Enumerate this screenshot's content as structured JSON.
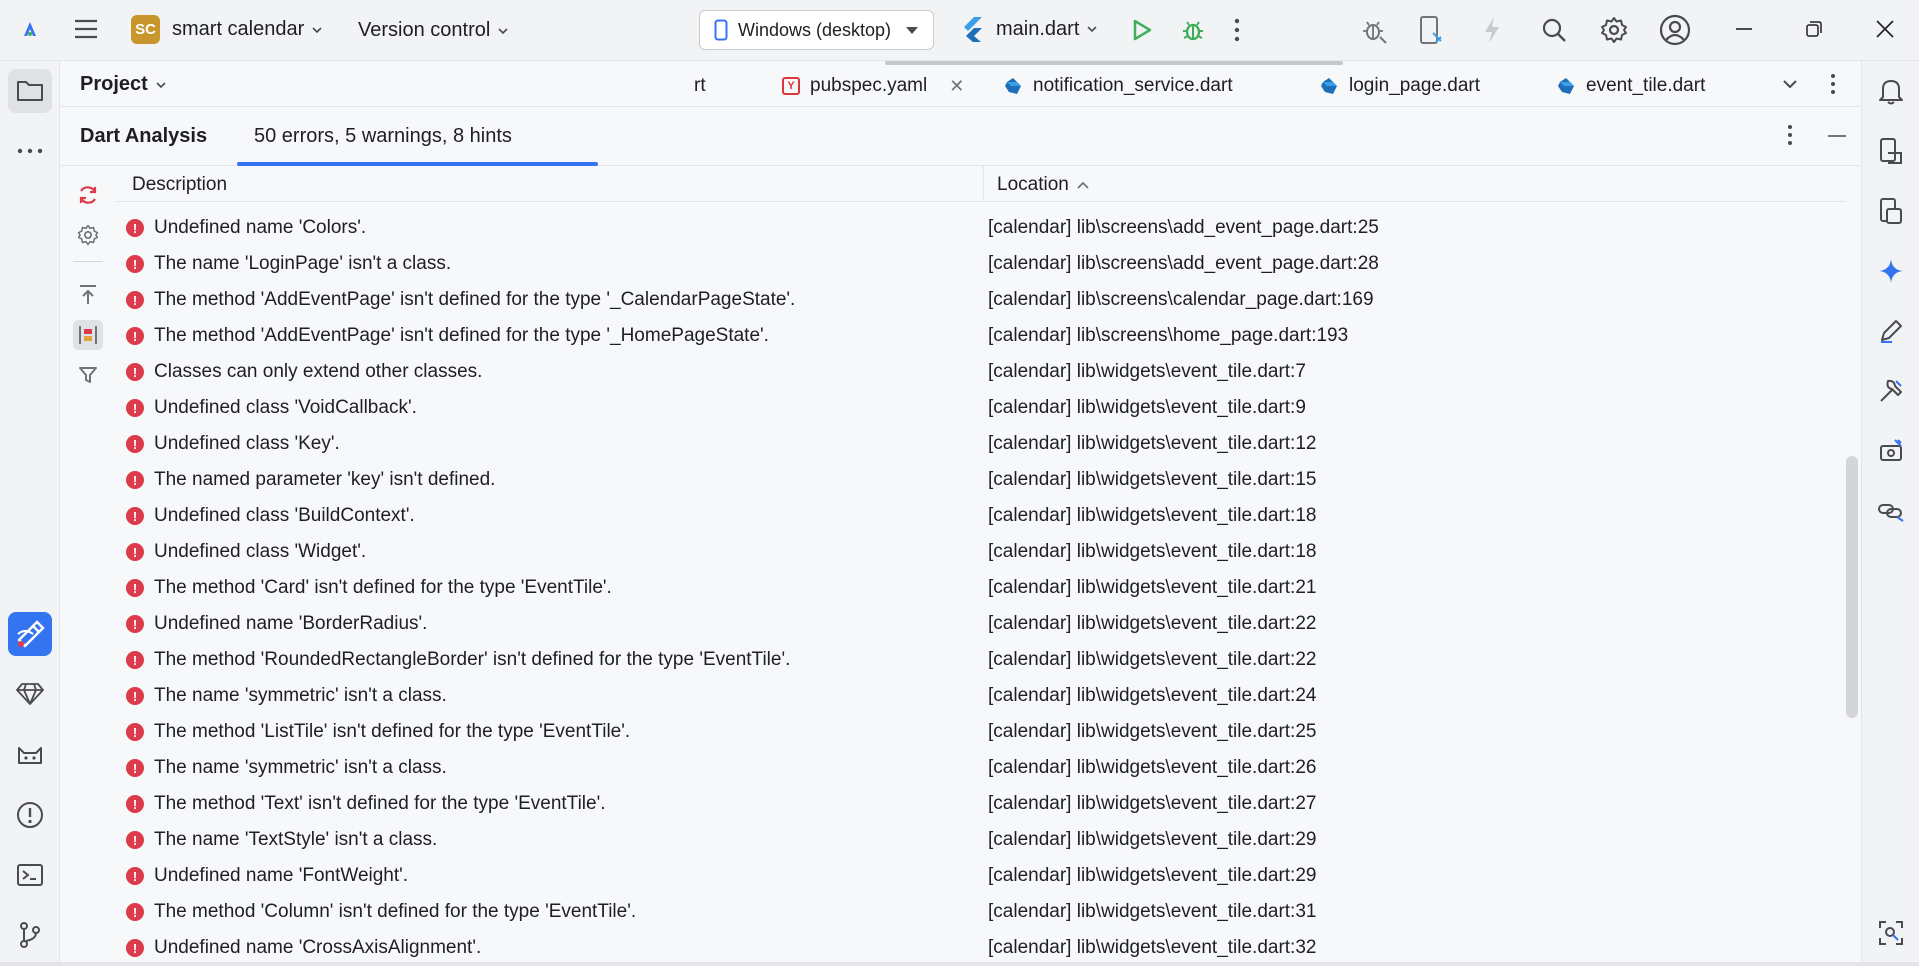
{
  "titlebar": {
    "project_badge": "SC",
    "project_name": "smart calendar",
    "vcs_label": "Version control",
    "device_label": "Windows (desktop)",
    "run_config": "main.dart"
  },
  "left_strip": {
    "items": [
      "folder-icon",
      "more-icon",
      "flutter-inspector-icon",
      "gem-icon",
      "cat-icon",
      "problems-icon",
      "terminal-icon",
      "git-icon"
    ]
  },
  "project_header": {
    "title": "Project",
    "tabs": [
      {
        "label": "rt",
        "icon": "dart-icon"
      },
      {
        "label": "pubspec.yaml",
        "icon": "yaml-icon",
        "closable": true
      },
      {
        "label": "notification_service.dart",
        "icon": "dart-icon"
      },
      {
        "label": "login_page.dart",
        "icon": "dart-icon"
      },
      {
        "label": "event_tile.dart",
        "icon": "dart-icon"
      }
    ]
  },
  "analysis": {
    "title": "Dart Analysis",
    "summary_tab": "50 errors, 5 warnings, 8 hints",
    "columns": {
      "description": "Description",
      "location": "Location"
    },
    "rows": [
      {
        "description": "Undefined name 'Colors'.",
        "location": "[calendar] lib\\screens\\add_event_page.dart:25"
      },
      {
        "description": "The name 'LoginPage' isn't a class.",
        "location": "[calendar] lib\\screens\\add_event_page.dart:28"
      },
      {
        "description": "The method 'AddEventPage' isn't defined for the type '_CalendarPageState'.",
        "location": "[calendar] lib\\screens\\calendar_page.dart:169"
      },
      {
        "description": "The method 'AddEventPage' isn't defined for the type '_HomePageState'.",
        "location": "[calendar] lib\\screens\\home_page.dart:193"
      },
      {
        "description": "Classes can only extend other classes.",
        "location": "[calendar] lib\\widgets\\event_tile.dart:7"
      },
      {
        "description": "Undefined class 'VoidCallback'.",
        "location": "[calendar] lib\\widgets\\event_tile.dart:9"
      },
      {
        "description": "Undefined class 'Key'.",
        "location": "[calendar] lib\\widgets\\event_tile.dart:12"
      },
      {
        "description": "The named parameter 'key' isn't defined.",
        "location": "[calendar] lib\\widgets\\event_tile.dart:15"
      },
      {
        "description": "Undefined class 'BuildContext'.",
        "location": "[calendar] lib\\widgets\\event_tile.dart:18"
      },
      {
        "description": "Undefined class 'Widget'.",
        "location": "[calendar] lib\\widgets\\event_tile.dart:18"
      },
      {
        "description": "The method 'Card' isn't defined for the type 'EventTile'.",
        "location": "[calendar] lib\\widgets\\event_tile.dart:21"
      },
      {
        "description": "Undefined name 'BorderRadius'.",
        "location": "[calendar] lib\\widgets\\event_tile.dart:22"
      },
      {
        "description": "The method 'RoundedRectangleBorder' isn't defined for the type 'EventTile'.",
        "location": "[calendar] lib\\widgets\\event_tile.dart:22"
      },
      {
        "description": "The name 'symmetric' isn't a class.",
        "location": "[calendar] lib\\widgets\\event_tile.dart:24"
      },
      {
        "description": "The method 'ListTile' isn't defined for the type 'EventTile'.",
        "location": "[calendar] lib\\widgets\\event_tile.dart:25"
      },
      {
        "description": "The name 'symmetric' isn't a class.",
        "location": "[calendar] lib\\widgets\\event_tile.dart:26"
      },
      {
        "description": "The method 'Text' isn't defined for the type 'EventTile'.",
        "location": "[calendar] lib\\widgets\\event_tile.dart:27"
      },
      {
        "description": "The name 'TextStyle' isn't a class.",
        "location": "[calendar] lib\\widgets\\event_tile.dart:29"
      },
      {
        "description": "Undefined name 'FontWeight'.",
        "location": "[calendar] lib\\widgets\\event_tile.dart:29"
      },
      {
        "description": "The method 'Column' isn't defined for the type 'EventTile'.",
        "location": "[calendar] lib\\widgets\\event_tile.dart:31"
      },
      {
        "description": "Undefined name 'CrossAxisAlignment'.",
        "location": "[calendar] lib\\widgets\\event_tile.dart:32"
      }
    ]
  },
  "colors": {
    "accent": "#3574f0",
    "error": "#db3b4b",
    "run": "#3fae5b",
    "project_badge": "#c9962d"
  }
}
